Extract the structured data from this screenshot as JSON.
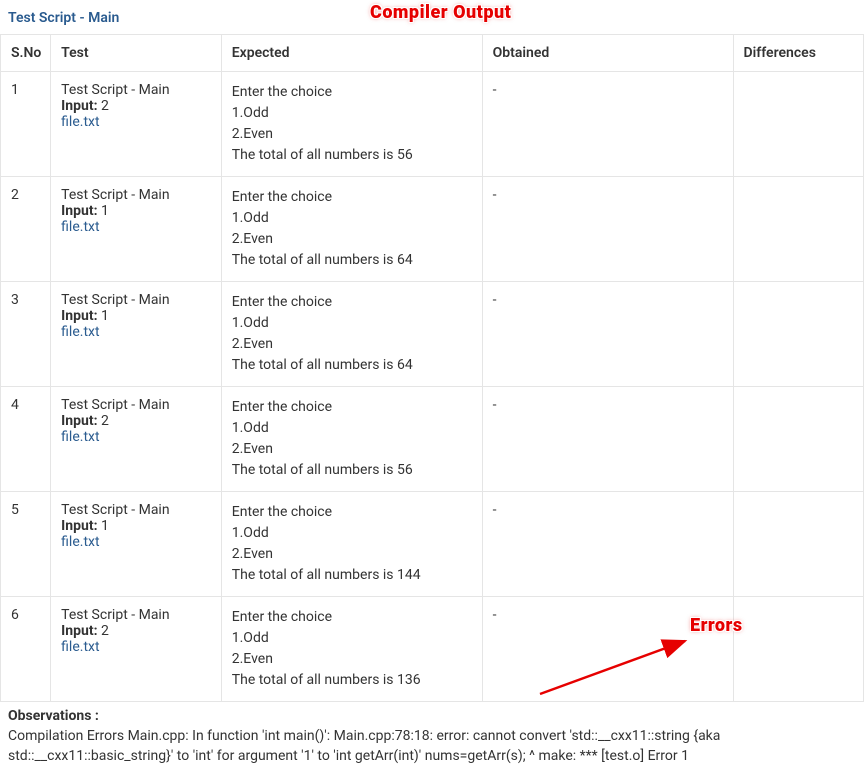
{
  "header": {
    "title": "Test Script - Main"
  },
  "annotations": {
    "compiler_output": "Compiler Output",
    "errors": "Errors"
  },
  "table": {
    "columns": {
      "sno": "S.No",
      "test": "Test",
      "expected": "Expected",
      "obtained": "Obtained",
      "differences": "Differences"
    },
    "rows": [
      {
        "sno": "1",
        "test_name": "Test Script - Main",
        "input_label": "Input:",
        "input_value": "2",
        "file_link": "file.txt",
        "expected": [
          "Enter the choice",
          "1.Odd",
          "2.Even",
          "The total of all numbers is 56"
        ],
        "obtained": "-",
        "differences": ""
      },
      {
        "sno": "2",
        "test_name": "Test Script - Main",
        "input_label": "Input:",
        "input_value": "1",
        "file_link": "file.txt",
        "expected": [
          "Enter the choice",
          "1.Odd",
          "2.Even",
          "The total of all numbers is 64"
        ],
        "obtained": "-",
        "differences": ""
      },
      {
        "sno": "3",
        "test_name": "Test Script - Main",
        "input_label": "Input:",
        "input_value": "1",
        "file_link": "file.txt",
        "expected": [
          "Enter the choice",
          "1.Odd",
          "2.Even",
          "The total of all numbers is 64"
        ],
        "obtained": "-",
        "differences": ""
      },
      {
        "sno": "4",
        "test_name": "Test Script - Main",
        "input_label": "Input:",
        "input_value": "2",
        "file_link": "file.txt",
        "expected": [
          "Enter the choice",
          "1.Odd",
          "2.Even",
          "The total of all numbers is 56"
        ],
        "obtained": "-",
        "differences": ""
      },
      {
        "sno": "5",
        "test_name": "Test Script - Main",
        "input_label": "Input:",
        "input_value": "1",
        "file_link": "file.txt",
        "expected": [
          "Enter the choice",
          "1.Odd",
          "2.Even",
          "The total of all numbers is 144"
        ],
        "obtained": "-",
        "differences": ""
      },
      {
        "sno": "6",
        "test_name": "Test Script - Main",
        "input_label": "Input:",
        "input_value": "2",
        "file_link": "file.txt",
        "expected": [
          "Enter the choice",
          "1.Odd",
          "2.Even",
          "The total of all numbers is 136"
        ],
        "obtained": "-",
        "differences": ""
      }
    ]
  },
  "observations": {
    "title": "Observations :",
    "body": "Compilation Errors Main.cpp: In function 'int main()': Main.cpp:78:18: error: cannot convert 'std::__cxx11::string {aka std::__cxx11::basic_string}' to 'int' for argument '1' to 'int getArr(int)' nums=getArr(s); ^ make: *** [test.o] Error 1"
  }
}
